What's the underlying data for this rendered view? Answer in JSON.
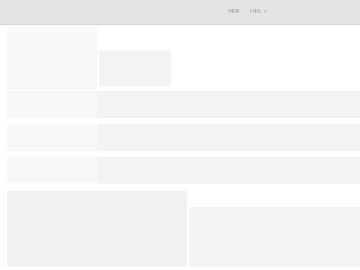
{
  "header": {
    "nav": [
      {
        "label": "HEM"
      },
      {
        "label": "LIES",
        "has_dropdown": true
      }
    ]
  }
}
